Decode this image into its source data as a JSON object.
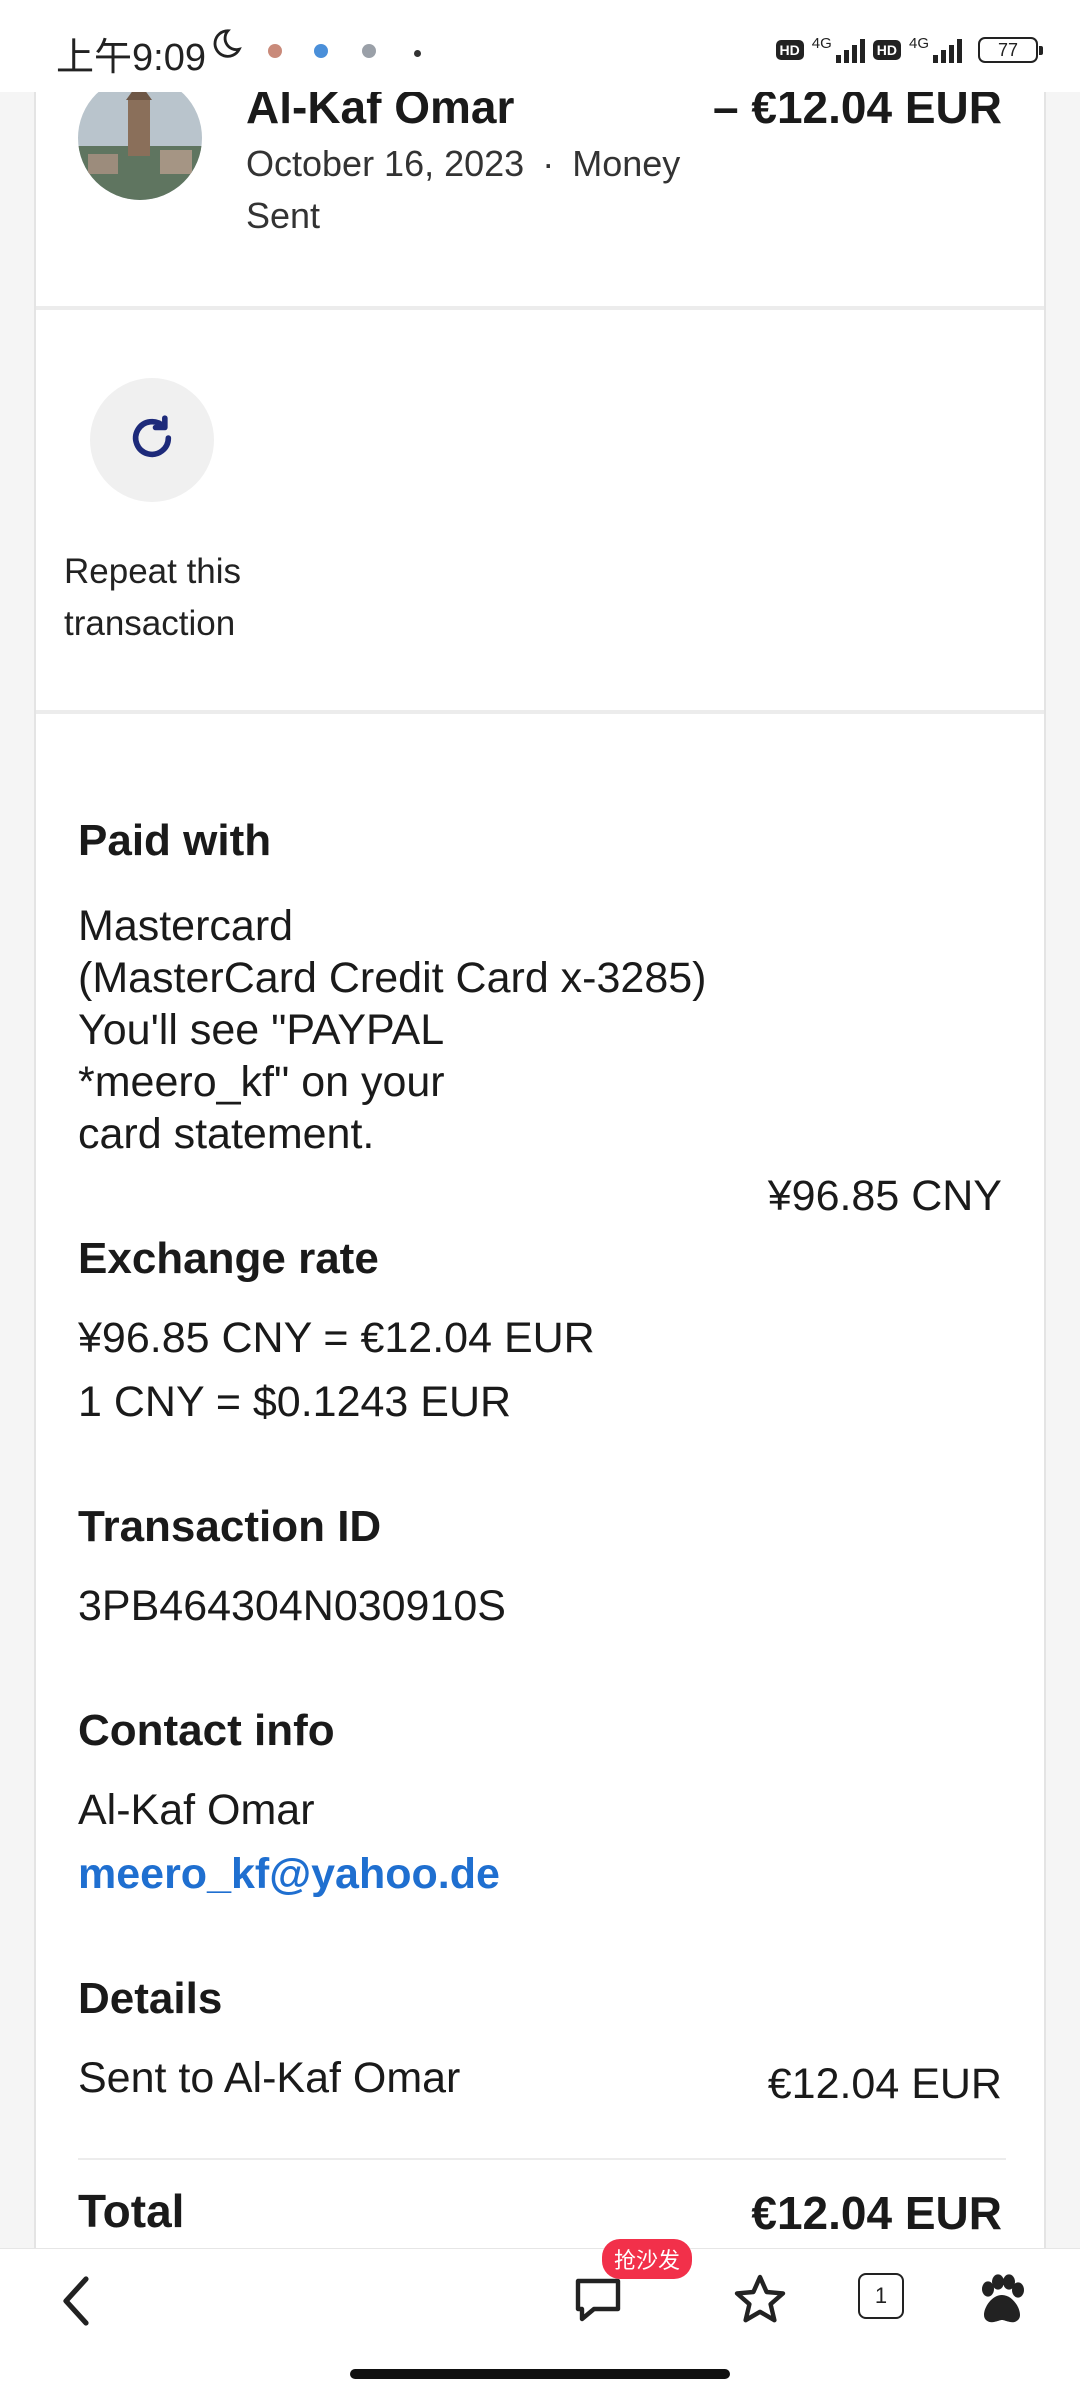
{
  "status_bar": {
    "time": "上午9:09",
    "hd1": "HD",
    "net1": "4G",
    "hd2": "HD",
    "net2": "4G",
    "battery": "77",
    "icons": [
      "moon-icon",
      "app-notification-icon",
      "signal-icon",
      "battery-icon"
    ]
  },
  "transaction": {
    "name": "Al-Kaf Omar",
    "date": "October 16, 2023",
    "separator": "·",
    "type": "Money Sent",
    "amount": "– €12.04 EUR"
  },
  "repeat": {
    "label": "Repeat this transaction",
    "icon": "refresh-icon"
  },
  "paid_with": {
    "title": "Paid with",
    "method": "Mastercard",
    "card": "(MasterCard Credit Card x-3285)",
    "note_line1": "You'll see \"PAYPAL",
    "note_line2": "*meero_kf\" on your",
    "note_line3": "card statement.",
    "amount": "¥96.85 CNY"
  },
  "exchange": {
    "title": "Exchange rate",
    "line1": "¥96.85 CNY = €12.04 EUR",
    "line2": "1 CNY = $0.1243 EUR"
  },
  "txid": {
    "title": "Transaction ID",
    "value": "3PB464304N030910S"
  },
  "contact": {
    "title": "Contact info",
    "name": "Al-Kaf Omar",
    "email": "meero_kf@yahoo.de"
  },
  "details": {
    "title": "Details",
    "sent_to_label": "Sent to Al-Kaf Omar",
    "sent_to_amount": "€12.04 EUR",
    "total_label": "Total",
    "total_amount": "€12.04 EUR"
  },
  "bottom_nav": {
    "badge": "抢沙发",
    "tab_count": "1",
    "icons": [
      "back-icon",
      "comment-icon",
      "star-icon",
      "tabs-icon",
      "baidu-paw-icon"
    ]
  },
  "colors": {
    "link": "#1f6fd0",
    "accent_icon": "#1d2a7a",
    "badge": "#f2304a"
  }
}
